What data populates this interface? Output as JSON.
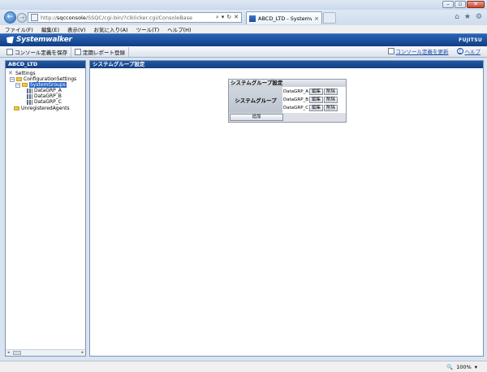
{
  "browser": {
    "url_prefix": "http://",
    "url_host": "sqcconsole",
    "url_path": "/SSQC/cgi-bin/?clklicker.cgi/ConsoleBase",
    "tab_title": "ABCD_LTD - Systemwal...",
    "tab_close": "×",
    "address_buttons": [
      "⌕",
      "▾",
      "↻",
      "✕"
    ]
  },
  "menu": [
    "ファイル(F)",
    "編集(E)",
    "表示(V)",
    "お気に入り(A)",
    "ツール(T)",
    "ヘルプ(H)"
  ],
  "app": {
    "brand": "Systemwalker",
    "maker": "FUJITSU"
  },
  "actions": {
    "save_label": "コンソール定義を保存",
    "policy_label": "定期レポート登録",
    "refresh_label": "コンソール定義を更新",
    "help_label": "ヘルプ"
  },
  "left_panel": {
    "title": "ABCD_LTD",
    "tree": {
      "settings": "Settings",
      "configuration": "ConfigurationSettings",
      "system_groups": "SystemGroups",
      "groups": [
        "DataGRP_A",
        "DataGRP_B",
        "DataGRP_C"
      ],
      "unregistered": "UnregisteredAgents"
    }
  },
  "right_panel": {
    "title": "システムグループ設定",
    "table_title": "システムグループ設定",
    "row_label": "システムグループ",
    "rows": [
      {
        "name": "DataGRP_A",
        "edit": "編集",
        "delete": "削除"
      },
      {
        "name": "DataGRP_B",
        "edit": "編集",
        "delete": "削除"
      },
      {
        "name": "DataGRP_C",
        "edit": "編集",
        "delete": "削除"
      }
    ],
    "add_label": "追加"
  },
  "status": {
    "zoom": "100%"
  },
  "colors": {
    "header_blue": "#1a4b96",
    "selection": "#2a64c8"
  }
}
